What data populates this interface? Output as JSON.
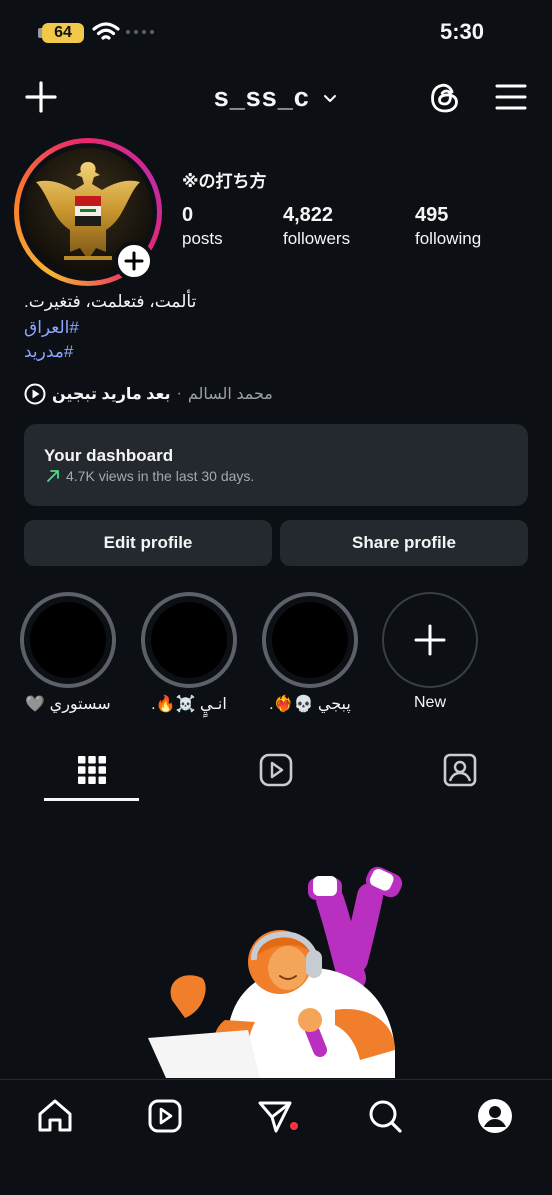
{
  "status_bar": {
    "battery": "64",
    "time": "5:30"
  },
  "header": {
    "username": "s_ss_c"
  },
  "profile": {
    "display_name": "※の打ち方",
    "stats": [
      {
        "value": "0",
        "label": "posts"
      },
      {
        "value": "4,822",
        "label": "followers"
      },
      {
        "value": "495",
        "label": "following"
      }
    ],
    "bio": "تألمت، فتعلمت، فتغيرت.",
    "hashtags": [
      "#العراق",
      "#مدريد"
    ],
    "music": {
      "title": "بعد ماريد تبجين",
      "separator": "·",
      "artist": "محمد السالم"
    }
  },
  "dashboard": {
    "title": "Your dashboard",
    "subtitle": "4.7K views in the last 30 days."
  },
  "buttons": {
    "edit": "Edit profile",
    "share": "Share profile"
  },
  "highlights": [
    {
      "label": "سستوري 🩶"
    },
    {
      "label": "انـيٍ ☠️🔥."
    },
    {
      "label": "پبجي 💀❤️‍🔥."
    },
    {
      "label": "New"
    }
  ],
  "colors": {
    "background": "#0c0f14",
    "card": "#24282f",
    "hashtag": "#8ea6ff",
    "accent_dot": "#ff3040",
    "trend": "#4ade80"
  },
  "icons": {
    "top_nav": [
      "plus-icon",
      "chevron-down-icon",
      "threads-icon",
      "menu-icon"
    ],
    "tabs": [
      "grid-icon",
      "reels-icon",
      "tagged-icon"
    ],
    "bottom_nav": [
      "home-icon",
      "reels-icon",
      "direct-message-icon",
      "search-icon",
      "profile-icon"
    ]
  }
}
